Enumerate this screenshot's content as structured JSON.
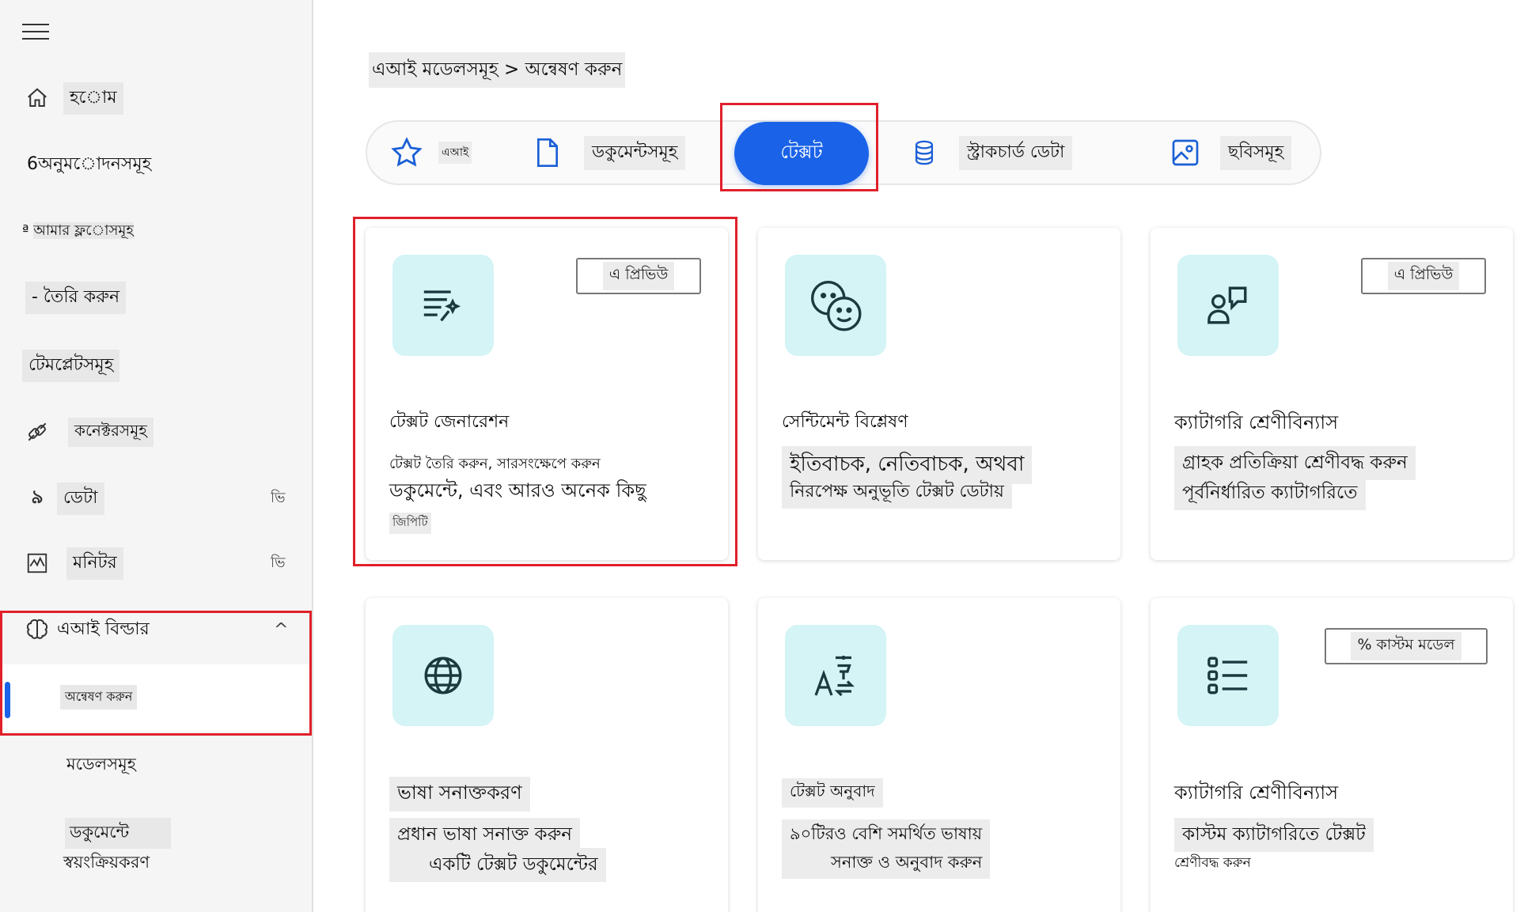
{
  "sidebar": {
    "items": [
      {
        "label": "হ◌োম",
        "icon": "home-icon"
      },
      {
        "label": "অনুম◌োদনসমূহ",
        "prefix": "6"
      },
      {
        "label": "আমার ফ্ল◌োসমূহ",
        "prefix": "ª"
      },
      {
        "label": "- তৈরি করুন"
      },
      {
        "label": "টেমপ্লেটসমূহ"
      },
      {
        "label": "কনেক্টরসমূহ",
        "icon": "connector-icon"
      },
      {
        "label": "ডেটা",
        "icon": "data-icon",
        "chev": "ভি"
      },
      {
        "label": "মনিটর",
        "icon": "monitor-icon",
        "chev": "ভি"
      },
      {
        "label": "এআই বিল্ডার",
        "icon": "brain-icon",
        "chev": "^"
      }
    ],
    "sub_explore": "অন্বেষণ করুন",
    "sub_models": "মডেলসমূহ",
    "sub_doc_line1": "ডকুমেন্টে",
    "sub_doc_line2": "স্বয়ংক্রিয়করণ"
  },
  "breadcrumb": "এআই মডেলসমূহ > অন্বেষণ করুন",
  "tabs": [
    {
      "label": "এআই",
      "icon": "star-icon"
    },
    {
      "label": "ডকুমেন্টসমূহ",
      "icon": "document-icon"
    },
    {
      "label": "টেক্সট",
      "active": true
    },
    {
      "label": "স্ট্রাকচার্ড ডেটা",
      "icon": "database-icon"
    },
    {
      "label": "ছবিসমূহ",
      "icon": "image-icon"
    }
  ],
  "cards": [
    {
      "title": "টেক্সট জেনারেশন",
      "badge": "এ প্রিভিউ",
      "line1": "টেক্সট তৈরি করুন, সারসংক্ষেপে করুন",
      "line2": "ডকুমেন্টে, এবং আরও অনেক কিছু",
      "tag": "জিপিটি",
      "icon": "text-generation-icon"
    },
    {
      "title": "সেন্টিমেন্ট বিশ্লেষণ",
      "line1": "ইতিবাচক, নেতিবাচক, অথবা",
      "line2": "নিরপেক্ষ অনুভূতি টেক্সট ডেটায়",
      "icon": "sentiment-icon"
    },
    {
      "title": "ক্যাটাগরি শ্রেণীবিন্যাস",
      "badge": "এ প্রিভিউ",
      "line1": "গ্রাহক প্রতিক্রিয়া শ্রেণীবদ্ধ করুন",
      "line2": "পূর্বনির্ধারিত ক্যাটাগরিতে",
      "icon": "category-classification-icon"
    },
    {
      "title": "ভাষা সনাক্তকরণ",
      "line1": "প্রধান ভাষা সনাক্ত করুন",
      "line2": "একটি টেক্সট ডকুমেন্টের",
      "icon": "globe-icon"
    },
    {
      "title": "টেক্সট অনুবাদ",
      "line1": "৯০টিরও বেশি সমর্থিত ভাষায়",
      "line2": "সনাক্ত ও অনুবাদ করুন",
      "icon": "translate-icon"
    },
    {
      "title": "ক্যাটাগরি শ্রেণীবিন্যাস",
      "badge": "% কাস্টম মডেল",
      "line1": "কাস্টম ক্যাটাগরিতে টেক্সট",
      "line2": "শ্রেণীবদ্ধ করুন",
      "icon": "list-icon"
    }
  ],
  "colors": {
    "accent": "#1a63e8",
    "icon_bg": "#d4f4f6",
    "highlight": "#e0202a"
  }
}
